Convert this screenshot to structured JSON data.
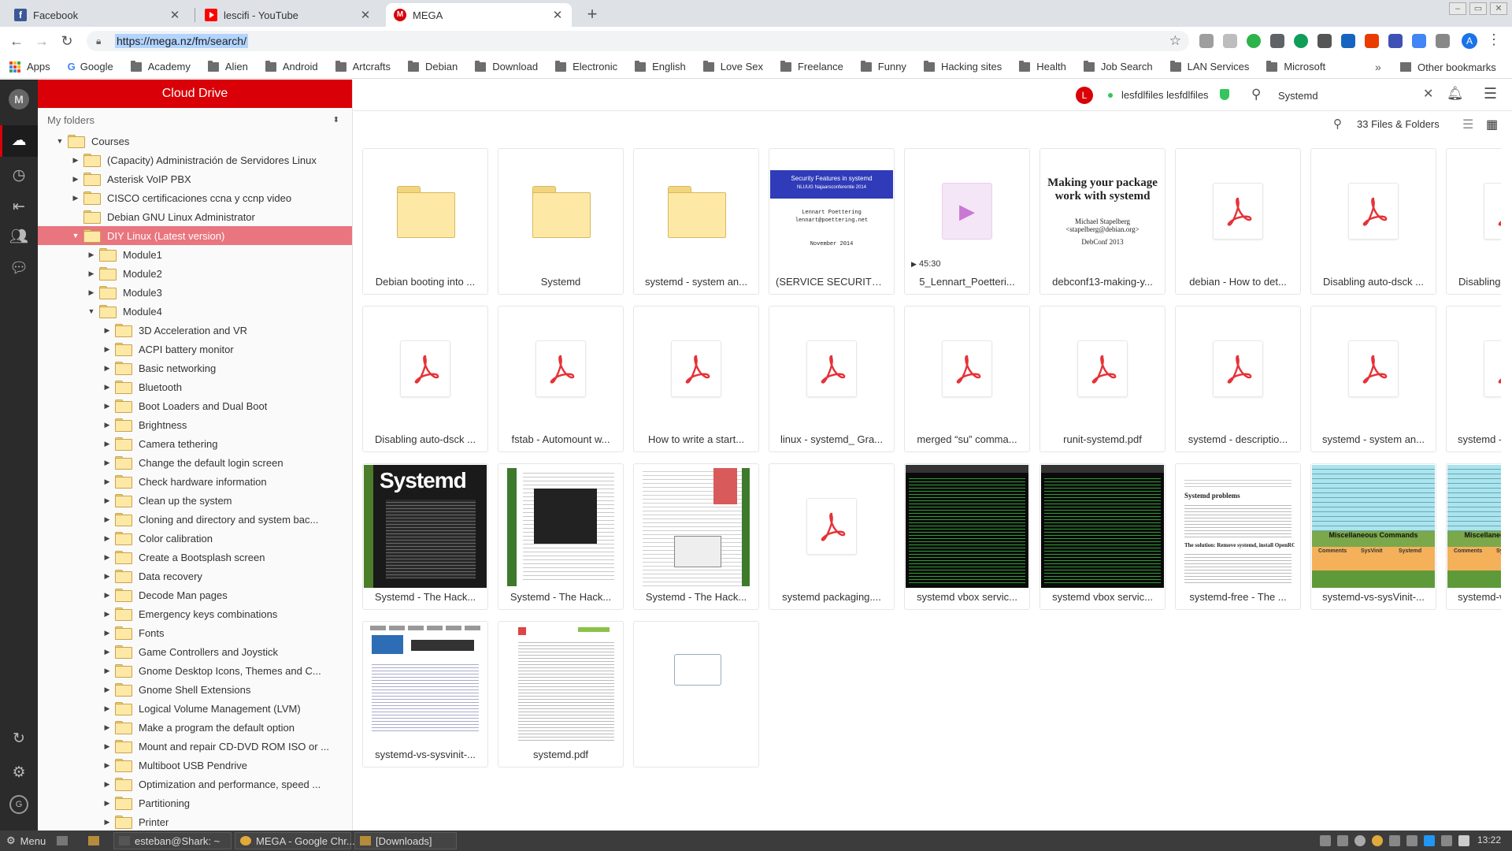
{
  "browser": {
    "tabs": [
      {
        "title": "Facebook",
        "icon": "facebook-icon",
        "color": "#3b5998"
      },
      {
        "title": "lescifi - YouTube",
        "icon": "youtube-icon",
        "color": "#ff0000"
      },
      {
        "title": "MEGA",
        "icon": "mega-icon",
        "color": "#d90007",
        "active": true
      }
    ],
    "url": "https://mega.nz/fm/search/",
    "bookmarks": [
      {
        "label": "Apps",
        "type": "apps"
      },
      {
        "label": "Google",
        "type": "google"
      },
      {
        "label": "Academy",
        "type": "folder"
      },
      {
        "label": "Alien",
        "type": "folder"
      },
      {
        "label": "Android",
        "type": "folder"
      },
      {
        "label": "Artcrafts",
        "type": "folder"
      },
      {
        "label": "Debian",
        "type": "folder"
      },
      {
        "label": "Download",
        "type": "folder"
      },
      {
        "label": "Electronic",
        "type": "folder"
      },
      {
        "label": "English",
        "type": "folder"
      },
      {
        "label": "Love Sex",
        "type": "folder"
      },
      {
        "label": "Freelance",
        "type": "folder"
      },
      {
        "label": "Funny",
        "type": "folder"
      },
      {
        "label": "Hacking sites",
        "type": "folder"
      },
      {
        "label": "Health",
        "type": "folder"
      },
      {
        "label": "Job Search",
        "type": "folder"
      },
      {
        "label": "LAN Services",
        "type": "folder"
      },
      {
        "label": "Microsoft",
        "type": "folder"
      }
    ],
    "bookmarks_more": "»",
    "other_bookmarks": "Other bookmarks",
    "profile_initial": "A"
  },
  "mega": {
    "logo": "M",
    "panel_title": "Cloud Drive",
    "my_folders": "My folders",
    "tree": [
      {
        "label": "Courses",
        "depth": 0,
        "arrow": "▼"
      },
      {
        "label": "(Capacity) Administración de Servidores Linux",
        "depth": 1,
        "arrow": "▶"
      },
      {
        "label": "Asterisk VoIP PBX",
        "depth": 1,
        "arrow": "▶"
      },
      {
        "label": "CISCO certificaciones ccna y ccnp video",
        "depth": 1,
        "arrow": "▶"
      },
      {
        "label": "Debian GNU Linux Administrator",
        "depth": 1,
        "arrow": ""
      },
      {
        "label": "DIY Linux (Latest version)",
        "depth": 1,
        "arrow": "▼",
        "selected": true
      },
      {
        "label": "Module1",
        "depth": 2,
        "arrow": "▶"
      },
      {
        "label": "Module2",
        "depth": 2,
        "arrow": "▶"
      },
      {
        "label": "Module3",
        "depth": 2,
        "arrow": "▶"
      },
      {
        "label": "Module4",
        "depth": 2,
        "arrow": "▼"
      },
      {
        "label": "3D Acceleration and VR",
        "depth": 3,
        "arrow": "▶"
      },
      {
        "label": "ACPI battery monitor",
        "depth": 3,
        "arrow": "▶"
      },
      {
        "label": "Basic networking",
        "depth": 3,
        "arrow": "▶"
      },
      {
        "label": "Bluetooth",
        "depth": 3,
        "arrow": "▶"
      },
      {
        "label": "Boot Loaders and Dual Boot",
        "depth": 3,
        "arrow": "▶"
      },
      {
        "label": "Brightness",
        "depth": 3,
        "arrow": "▶"
      },
      {
        "label": "Camera tethering",
        "depth": 3,
        "arrow": "▶"
      },
      {
        "label": "Change the default login screen",
        "depth": 3,
        "arrow": "▶"
      },
      {
        "label": "Check hardware information",
        "depth": 3,
        "arrow": "▶"
      },
      {
        "label": "Clean up the system",
        "depth": 3,
        "arrow": "▶"
      },
      {
        "label": "Cloning and directory and system bac...",
        "depth": 3,
        "arrow": "▶"
      },
      {
        "label": "Color calibration",
        "depth": 3,
        "arrow": "▶"
      },
      {
        "label": "Create a Bootsplash screen",
        "depth": 3,
        "arrow": "▶"
      },
      {
        "label": "Data recovery",
        "depth": 3,
        "arrow": "▶"
      },
      {
        "label": "Decode Man pages",
        "depth": 3,
        "arrow": "▶"
      },
      {
        "label": "Emergency keys combinations",
        "depth": 3,
        "arrow": "▶"
      },
      {
        "label": "Fonts",
        "depth": 3,
        "arrow": "▶"
      },
      {
        "label": "Game Controllers and Joystick",
        "depth": 3,
        "arrow": "▶"
      },
      {
        "label": "Gnome Desktop Icons, Themes and C...",
        "depth": 3,
        "arrow": "▶"
      },
      {
        "label": "Gnome Shell Extensions",
        "depth": 3,
        "arrow": "▶"
      },
      {
        "label": "Logical Volume Management (LVM)",
        "depth": 3,
        "arrow": "▶"
      },
      {
        "label": "Make a program the default option",
        "depth": 3,
        "arrow": "▶"
      },
      {
        "label": "Mount and repair CD-DVD ROM ISO or ...",
        "depth": 3,
        "arrow": "▶"
      },
      {
        "label": "Multiboot USB Pendrive",
        "depth": 3,
        "arrow": "▶"
      },
      {
        "label": "Optimization and performance, speed ...",
        "depth": 3,
        "arrow": "▶"
      },
      {
        "label": "Partitioning",
        "depth": 3,
        "arrow": "▶"
      },
      {
        "label": "Printer",
        "depth": 3,
        "arrow": "▶"
      }
    ],
    "user_initial": "L",
    "username": "lesfdlfiles lesfdlfiles",
    "search_value": "Systemd",
    "results_count": "33 Files & Folders",
    "files": [
      {
        "name": "Debian booting into ...",
        "kind": "folder"
      },
      {
        "name": "Systemd",
        "kind": "folder"
      },
      {
        "name": "systemd - system an...",
        "kind": "folder"
      },
      {
        "name": "(SERVICE SECURITY) ...",
        "kind": "slide",
        "thumb_title": "Security Features in systemd",
        "thumb_sub": "NLUUG Najaarsconferentie 2014",
        "thumb_author": "Lennart Poettering",
        "thumb_email": "lennart@poettering.net",
        "thumb_date": "November 2014"
      },
      {
        "name": "5_Lennart_Poetteri...",
        "kind": "video",
        "duration": "45:30"
      },
      {
        "name": "debconf13-making-y...",
        "kind": "slide2",
        "thumb_title": "Making your package work with systemd",
        "thumb_author": "Michael Stapelberg <stapelberg@debian.org>",
        "thumb_date": "DebConf 2013"
      },
      {
        "name": "debian - How to det...",
        "kind": "pdf"
      },
      {
        "name": "Disabling auto-dsck ...",
        "kind": "pdf"
      },
      {
        "name": "Disabling auto-dsck ...",
        "kind": "pdf"
      },
      {
        "name": "Disabling auto-dsck ...",
        "kind": "pdf",
        "hover": true
      },
      {
        "name": "Disabling auto-dsck ...",
        "kind": "pdf"
      },
      {
        "name": "fstab - Automount w...",
        "kind": "pdf"
      },
      {
        "name": "How to write a start...",
        "kind": "pdf"
      },
      {
        "name": "linux - systemd_ Gra...",
        "kind": "pdf"
      },
      {
        "name": "merged “su” comma...",
        "kind": "pdf"
      },
      {
        "name": "runit-systemd.pdf",
        "kind": "pdf"
      },
      {
        "name": "systemd - descriptio...",
        "kind": "pdf"
      },
      {
        "name": "systemd - system an...",
        "kind": "pdf"
      },
      {
        "name": "systemd - system an...",
        "kind": "pdf"
      },
      {
        "name": "Systemd - The Hack...",
        "kind": "magazine",
        "thumb_title": "Systemd"
      },
      {
        "name": "Systemd - The Hack...",
        "kind": "magazine",
        "thumb_title": "Systemd"
      },
      {
        "name": "Systemd - The Hack...",
        "kind": "magpage"
      },
      {
        "name": "Systemd - The Hack...",
        "kind": "magpage2"
      },
      {
        "name": "systemd packaging....",
        "kind": "pdf"
      },
      {
        "name": "systemd vbox servic...",
        "kind": "terminal"
      },
      {
        "name": "systemd vbox servic...",
        "kind": "terminal"
      },
      {
        "name": "systemd-free - The ...",
        "kind": "article",
        "thumb_title": "Systemd problems",
        "thumb_sub": "The solution: Remove systemd, install OpenRC"
      },
      {
        "name": "systemd-vs-sysVinit-...",
        "kind": "compare",
        "thumb_title": "Miscellaneous Commands",
        "thumb_c1": "Comments",
        "thumb_c2": "SysVinit",
        "thumb_c3": "Systemd"
      },
      {
        "name": "systemd-vs-sysVinit-...",
        "kind": "compare",
        "thumb_title": "Miscellaneous Commands",
        "thumb_c1": "Comments",
        "thumb_c2": "SysVinit",
        "thumb_c3": "Systemd"
      },
      {
        "name": "systemd-vs-sysVinit-...",
        "kind": "compare",
        "thumb_title": "Miscellaneous Commands",
        "thumb_c1": "Comments",
        "thumb_c2": "SysVinit",
        "thumb_c3": "Systemd"
      },
      {
        "name": "systemd-vs-sysvinit-...",
        "kind": "webpage"
      },
      {
        "name": "systemd.pdf",
        "kind": "webpage2"
      },
      {
        "name": "",
        "kind": "partial"
      }
    ]
  },
  "taskbar": {
    "menu": "Menu",
    "items": [
      {
        "label": "esteban@Shark: ~",
        "boxed": true
      },
      {
        "label": "MEGA - Google Chr...",
        "boxed": true
      },
      {
        "label": "[Downloads]",
        "boxed": true
      }
    ],
    "clock": "13:22"
  },
  "colors": {
    "brand": "#d90007",
    "selected_row": "#e9757e",
    "pdf_red": "#e53238"
  }
}
